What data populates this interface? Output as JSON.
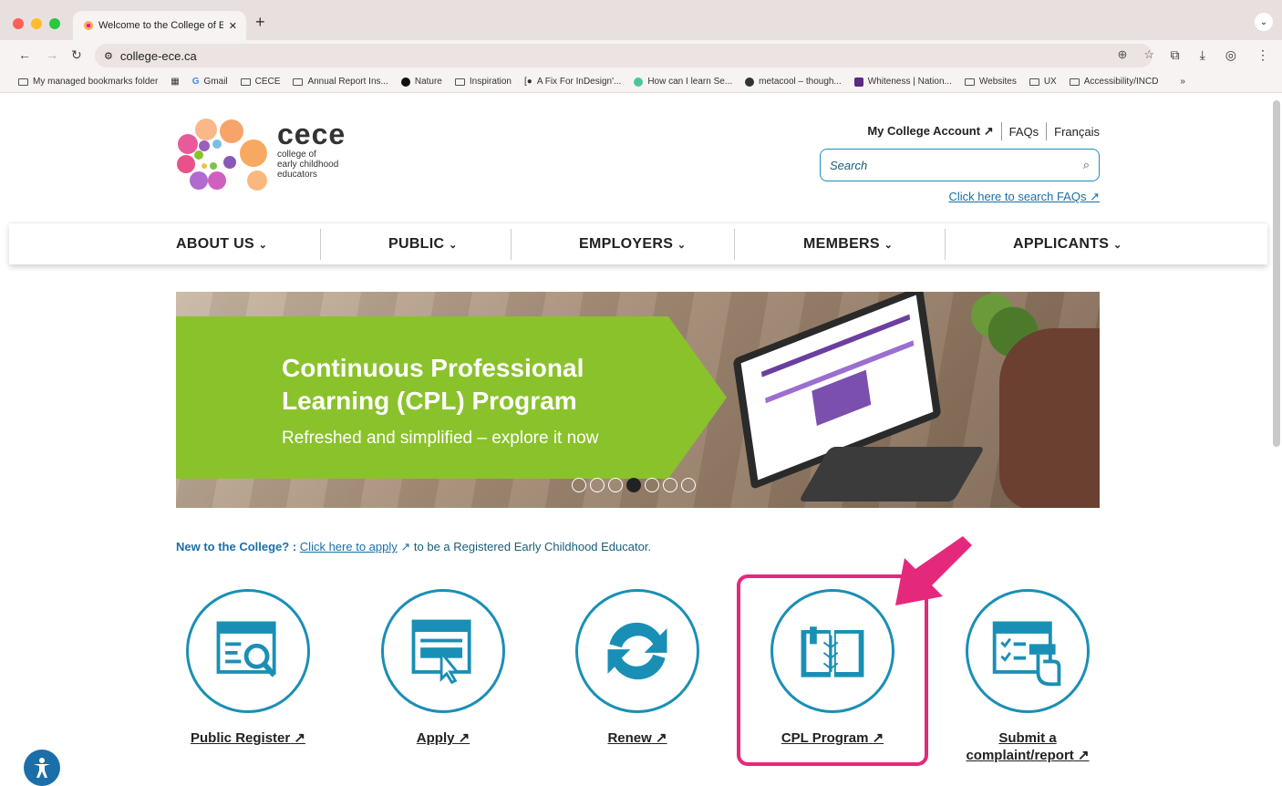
{
  "browser": {
    "tab_title": "Welcome to the College of Ea",
    "url": "college-ece.ca",
    "bookmarks": [
      "My managed bookmarks folder",
      "Gmail",
      "CECE",
      "Annual Report Ins...",
      "Nature",
      "Inspiration",
      "A Fix For InDesign'...",
      "How can I learn Se...",
      "metacool – though...",
      "Whiteness | Nation...",
      "Websites",
      "UX",
      "Accessibility/INCD"
    ],
    "more_label": "»"
  },
  "header": {
    "logo_word": "cece",
    "logo_sub_1": "college of",
    "logo_sub_2": "early childhood",
    "logo_sub_3": "educators",
    "account_link": "My College Account",
    "faqs_link": "FAQs",
    "language_link": "Français",
    "search_placeholder": "Search",
    "faq_search_link": "Click here to search FAQs"
  },
  "nav": {
    "items": [
      "ABOUT US",
      "PUBLIC",
      "EMPLOYERS",
      "MEMBERS",
      "APPLICANTS"
    ]
  },
  "hero": {
    "title": "Continuous Professional Learning (CPL) Program",
    "subtitle": "Refreshed and simplified – explore it now",
    "slide_count": 7,
    "active_slide": 4
  },
  "intro": {
    "lead": "New to the College? :",
    "link": "Click here to apply",
    "rest": "to be a Registered Early Childhood Educator."
  },
  "tiles": [
    {
      "label": "Public Register",
      "icon": "search-register-icon"
    },
    {
      "label": "Apply",
      "icon": "apply-click-icon"
    },
    {
      "label": "Renew",
      "icon": "renew-arrows-icon"
    },
    {
      "label": "CPL Program",
      "icon": "open-book-icon"
    },
    {
      "label": "Submit a complaint/report",
      "icon": "checklist-hand-icon"
    }
  ],
  "colors": {
    "brand_blue": "#1a8fb5",
    "hero_green": "#8ac22c",
    "highlight_pink": "#e4287c"
  }
}
